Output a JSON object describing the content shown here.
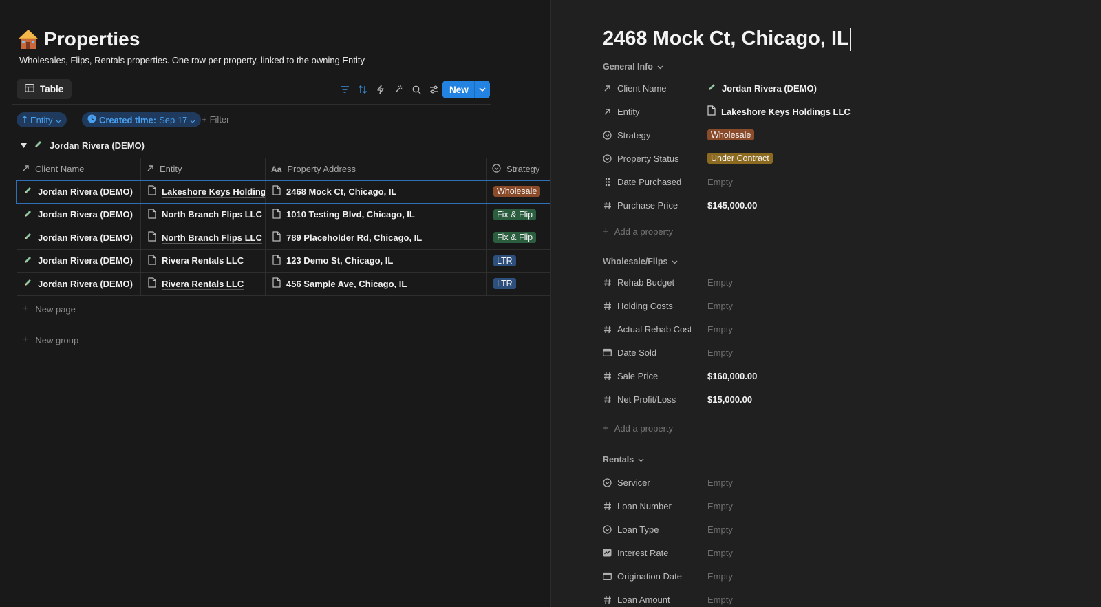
{
  "left": {
    "title": "Properties",
    "description": "Wholesales, Flips, Rentals properties. One row per property, linked to the owning Entity",
    "view_tab": "Table",
    "new_button": "New",
    "chips": {
      "entity": "Entity",
      "created_prefix": "Created time:",
      "created_value": "Sep 17"
    },
    "filter_label": "Filter",
    "group_name": "Jordan Rivera (DEMO)",
    "columns": [
      "Client Name",
      "Entity",
      "Property Address",
      "Strategy"
    ],
    "rows": [
      {
        "client": "Jordan Rivera (DEMO)",
        "entity": "Lakeshore Keys Holdings LLC",
        "address": "2468 Mock Ct, Chicago, IL",
        "strategy": "Wholesale"
      },
      {
        "client": "Jordan Rivera (DEMO)",
        "entity": "North Branch Flips LLC",
        "address": "1010 Testing Blvd, Chicago, IL",
        "strategy": "Fix & Flip"
      },
      {
        "client": "Jordan Rivera (DEMO)",
        "entity": "North Branch Flips LLC",
        "address": "789 Placeholder Rd, Chicago, IL",
        "strategy": "Fix & Flip"
      },
      {
        "client": "Jordan Rivera (DEMO)",
        "entity": "Rivera Rentals LLC",
        "address": "123 Demo St, Chicago, IL",
        "strategy": "LTR"
      },
      {
        "client": "Jordan Rivera (DEMO)",
        "entity": "Rivera Rentals LLC",
        "address": "456 Sample Ave, Chicago, IL",
        "strategy": "LTR"
      }
    ],
    "new_page": "New page",
    "new_group": "New group"
  },
  "right": {
    "title": "2468 Mock Ct, Chicago, IL",
    "sections": {
      "general": "General Info",
      "wholesale": "Wholesale/Flips",
      "rentals": "Rentals"
    },
    "add_property": "Add a property",
    "empty": "Empty",
    "general": {
      "client_name": {
        "label": "Client Name",
        "value": "Jordan Rivera (DEMO)"
      },
      "entity": {
        "label": "Entity",
        "value": "Lakeshore Keys Holdings LLC"
      },
      "strategy": {
        "label": "Strategy",
        "value": "Wholesale"
      },
      "status": {
        "label": "Property Status",
        "value": "Under Contract"
      },
      "date_purchased": {
        "label": "Date Purchased"
      },
      "purchase_price": {
        "label": "Purchase Price",
        "value": "$145,000.00"
      }
    },
    "wholesale": {
      "rehab_budget": {
        "label": "Rehab Budget"
      },
      "holding_costs": {
        "label": "Holding Costs"
      },
      "actual_rehab": {
        "label": "Actual Rehab Cost"
      },
      "date_sold": {
        "label": "Date Sold"
      },
      "sale_price": {
        "label": "Sale Price",
        "value": "$160,000.00"
      },
      "net_profit": {
        "label": "Net Profit/Loss",
        "value": "$15,000.00"
      }
    },
    "rentals": {
      "servicer": {
        "label": "Servicer"
      },
      "loan_number": {
        "label": "Loan Number"
      },
      "loan_type": {
        "label": "Loan Type"
      },
      "interest_rate": {
        "label": "Interest Rate"
      },
      "origination_date": {
        "label": "Origination Date"
      },
      "loan_amount": {
        "label": "Loan Amount"
      }
    }
  },
  "colors": {
    "accent": "#2383e2",
    "wholesale": "#8a4b2b",
    "fix_flip": "#2b5d3f",
    "ltr": "#2c4f7c",
    "under_contract": "#8c6a1f"
  }
}
